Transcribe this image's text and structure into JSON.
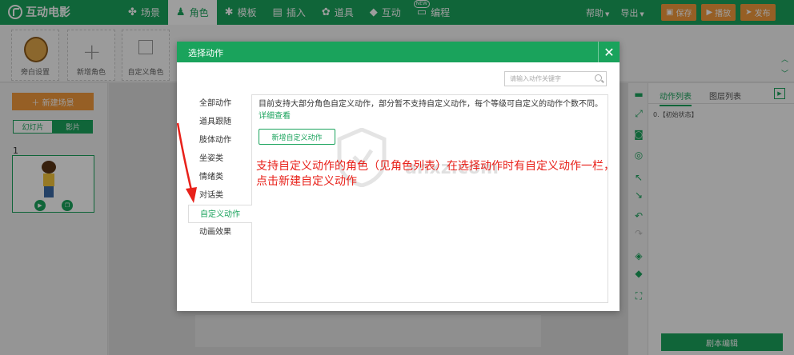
{
  "app": {
    "logo_text": "互动电影",
    "nav": [
      {
        "label": "场景",
        "icon": "scene-icon"
      },
      {
        "label": "角色",
        "icon": "character-icon"
      },
      {
        "label": "模板",
        "icon": "template-icon"
      },
      {
        "label": "插入",
        "icon": "insert-icon"
      },
      {
        "label": "道具",
        "icon": "prop-icon"
      },
      {
        "label": "互动",
        "icon": "interact-icon"
      },
      {
        "label": "编程",
        "icon": "code-icon",
        "badge": "NEW"
      }
    ],
    "menu": {
      "help": "帮助",
      "export": "导出"
    },
    "actions": {
      "save": "保存",
      "play": "播放",
      "publish": "发布"
    }
  },
  "char_toolbar": {
    "slots": [
      {
        "label": "旁白设置"
      },
      {
        "label": "新增角色"
      },
      {
        "label": "自定义角色"
      }
    ]
  },
  "left_panel": {
    "new_scene": "新建场景",
    "seg": {
      "slides": "幻灯片",
      "film": "影片"
    },
    "slide_number": "1"
  },
  "right_panel": {
    "tabs": {
      "action_list": "动作列表",
      "layer_list": "图层列表"
    },
    "state_item": "0.【初始状态】",
    "script_edit": "剧本编辑"
  },
  "dialog": {
    "title": "选择动作",
    "search_placeholder": "请输入动作关键字",
    "categories": [
      {
        "label": "全部动作"
      },
      {
        "label": "道具跟随"
      },
      {
        "label": "肢体动作"
      },
      {
        "label": "坐姿类"
      },
      {
        "label": "情绪类"
      },
      {
        "label": "对话类"
      },
      {
        "label": "自定义动作"
      },
      {
        "label": "动画效果"
      }
    ],
    "selected_index": 6,
    "description": "目前支持大部分角色自定义动作，部分暂不支持自定义动作，每个等级可自定义的动作个数不同。",
    "detail_link": "详细查看",
    "new_action_button": "新增自定义动作"
  },
  "annotation": {
    "text": "支持自定义动作的角色（见角色列表）在选择动作时有自定义动作一栏，点击新建自定义动作"
  },
  "watermark": {
    "text": "anxz.com"
  },
  "colors": {
    "brand_green": "#1aa35c",
    "orange": "#f39a3d",
    "annotation_red": "#e8211a"
  }
}
